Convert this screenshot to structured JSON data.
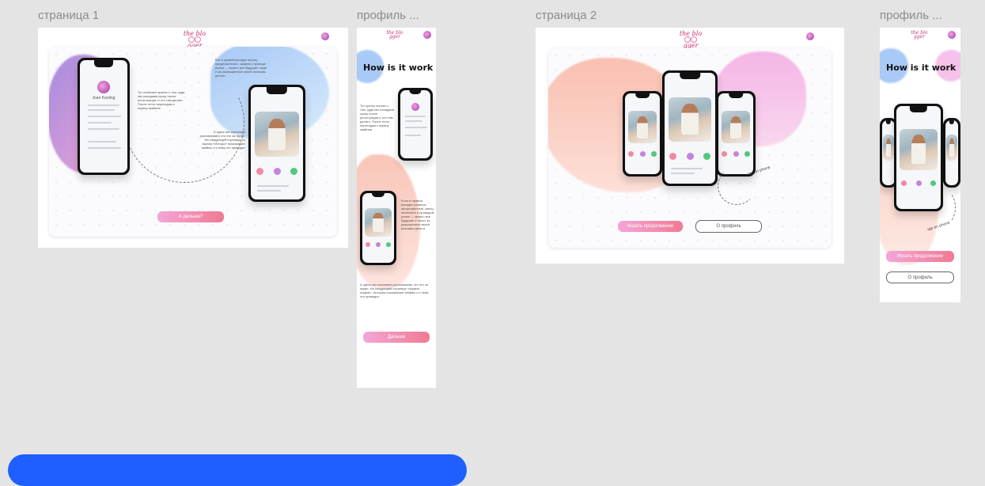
{
  "boards": {
    "page1": {
      "label": "страница 1",
      "text_block_1": "Тут написано кратко о том, куда мы попадаем сразу после регистрации, и что там делать. После этого переходим к экрану свайпов",
      "text_block_2": "А здесь мы начинаем рассказывать что это за экран. На следующей странице по экрану «Изтори» показывают свайпы и к чему это приводит",
      "text_block_3": "Вот в правой вкладке иконку предложенного, скажем к проводе рынка — можно все будущие люди и за разныщенные своей рекламы деньги",
      "profile_name": "Joan Keeling",
      "cta": "А дальше?"
    },
    "profile1": {
      "label": "профиль ...",
      "heading": "How is it work",
      "text_block_1": "Тут кратко писано о том, куда мы попадаем сразу после регистрации и что там делать. После этого переходим к экрану свайпов",
      "text_block_2": "Если в правом вкладке узнаешь предложенный, кипиц желаемое о провидом рынке — можно все будущие и понят за разыщенные своей рекламы деньги",
      "text_block_3": "А здесь мы начинаем рассказывать что это за экран. На следующей странице «экраны лифов». История показывают свайпы и к чему это приводит",
      "cta": "Дальше"
    },
    "page2": {
      "label": "страница 2",
      "cta_primary": "Искать продолжение",
      "cta_secondary": "О профиль",
      "annotation": "tap on phone"
    },
    "profile2": {
      "label": "профиль ...",
      "heading": "How is it work",
      "cta_primary": "Искать продолжение",
      "cta_secondary": "О профиль",
      "annotation": "tap on phone"
    }
  },
  "logo": {
    "line1": "the blo",
    "line2": "gger"
  },
  "colors": {
    "canvas": "#e4e4e4",
    "pink": "#f07a92",
    "lilac": "#f3a6d8",
    "blue": "#1f5fff"
  }
}
